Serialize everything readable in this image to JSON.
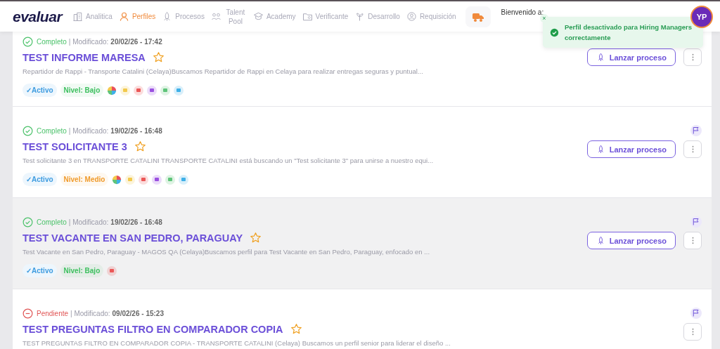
{
  "brand": {
    "logo": "evaluar"
  },
  "nav": [
    {
      "label": "Analitica",
      "selected": false
    },
    {
      "label": "Perfiles",
      "selected": true
    },
    {
      "label": "Procesos",
      "selected": false
    },
    {
      "label": "Talent Pool",
      "selected": false
    },
    {
      "label": "Academy",
      "selected": false
    },
    {
      "label": "Verificante",
      "selected": false
    },
    {
      "label": "Desarrollo",
      "selected": false
    },
    {
      "label": "Requisición",
      "selected": false
    }
  ],
  "user": {
    "greeting": "Bienvenido a:",
    "initials": "YP"
  },
  "toast": {
    "message": "Perfil desactivado para Hiring Managers correctamente",
    "close": "×"
  },
  "profiles": [
    {
      "pending": false,
      "status": "Completo",
      "modified_label": "| Modificado:",
      "date": "20/02/26 - 17:42",
      "title": "TEST INFORME MARESA",
      "description": "Repartidor de Rappi - Transporte Catalini (Celaya)Buscamos Repartidor de Rappi en Celaya para realizar entregas seguras y puntual...",
      "active": "✓Activo",
      "level": {
        "text": "Nivel: Bajo",
        "color": "#3cbf5e"
      },
      "tests": [
        {
          "kind": "wheel"
        },
        {
          "kind": "square",
          "color": "#f2c94c"
        },
        {
          "kind": "square",
          "color": "#eb5757"
        },
        {
          "kind": "square",
          "color": "#9b51e0"
        },
        {
          "kind": "square",
          "color": "#5fc47a"
        },
        {
          "kind": "square",
          "color": "#3fb0e8"
        }
      ],
      "launch_button": "Lanzar proceso",
      "highlighted": false
    },
    {
      "pending": false,
      "status": "Completo",
      "modified_label": "| Modificado:",
      "date": "19/02/26 - 16:48",
      "title": "TEST SOLICITANTE 3",
      "description": "Test solicitante 3 en TRANSPORTE CATALINI TRANSPORTE CATALINI está buscando un \"Test solicitante 3\" para unirse a nuestro equi...",
      "active": "✓Activo",
      "level": {
        "text": "Nivel: Medio",
        "color": "#f09a2a"
      },
      "tests": [
        {
          "kind": "wheel"
        },
        {
          "kind": "square",
          "color": "#f2c94c"
        },
        {
          "kind": "square",
          "color": "#eb5757"
        },
        {
          "kind": "square",
          "color": "#9b51e0"
        },
        {
          "kind": "square",
          "color": "#5fc47a"
        },
        {
          "kind": "square",
          "color": "#3fb0e8"
        }
      ],
      "launch_button": "Lanzar proceso",
      "highlighted": false
    },
    {
      "pending": false,
      "status": "Completo",
      "modified_label": "| Modificado:",
      "date": "19/02/26 - 16:48",
      "title": "TEST VACANTE EN SAN PEDRO, PARAGUAY",
      "description": "Test Vacante en San Pedro, Paraguay - MAGOS QA (Celaya)Buscamos perfil para Test Vacante en San Pedro, Paraguay, enfocado en ...",
      "active": "✓Activo",
      "level": {
        "text": "Nivel: Bajo",
        "color": "#3cbf5e"
      },
      "tests": [
        {
          "kind": "square",
          "color": "#eb5757"
        }
      ],
      "launch_button": "Lanzar proceso",
      "highlighted": true
    },
    {
      "pending": true,
      "status": "Pendiente",
      "modified_label": "| Modificado:",
      "date": "09/02/26 - 15:23",
      "title": "TEST PREGUNTAS FILTRO EN COMPARADOR COPIA",
      "description": "TEST PREGUNTAS FILTRO EN COMPARADOR COPIA - TRANSPORTE CATALINI (Celaya) Buscamos un perfil senior para liderar el diseño ...",
      "highlighted": false
    }
  ]
}
